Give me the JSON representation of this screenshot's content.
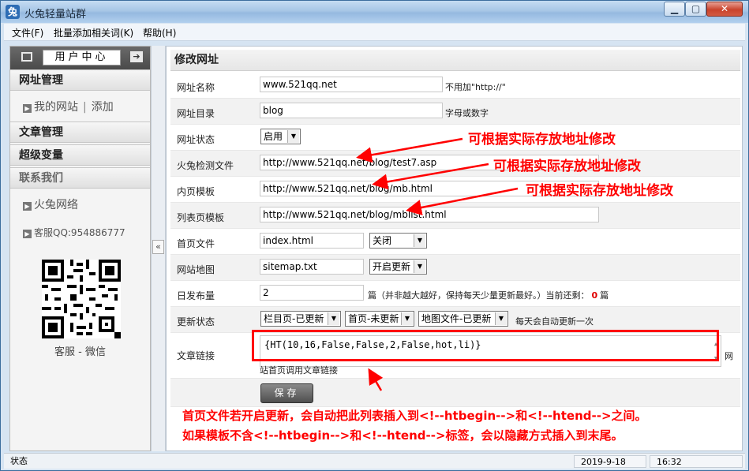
{
  "window": {
    "title": "火兔轻量站群",
    "minimize": "▁",
    "maximize": "▢",
    "close": "✕"
  },
  "menu": [
    "文件(F)",
    "批量添加相关词(K)",
    "帮助(H)"
  ],
  "sidebar": {
    "header_label": "用户中心",
    "arrow": "➔",
    "sections": {
      "site_manage": "网址管理",
      "my_sites": "我的网站",
      "add": "添加",
      "article_manage": "文章管理",
      "super_vars": "超级变量",
      "contact": "联系我们",
      "company": "火兔网络",
      "support_qq": "客服QQ:954886777"
    },
    "qr_caption": "客服 - 微信"
  },
  "collapse": "«",
  "main": {
    "title": "修改网址",
    "rows": {
      "name": {
        "label": "网址名称",
        "value": "www.521qq.net",
        "hint": "不用加\"http://\""
      },
      "dir": {
        "label": "网址目录",
        "value": "blog",
        "hint": "字母或数字"
      },
      "status": {
        "label": "网址状态",
        "value": "启用"
      },
      "check_file": {
        "label": "火兔检测文件",
        "value": "http://www.521qq.net/blog/test7.asp"
      },
      "content_tpl": {
        "label": "内页模板",
        "value": "http://www.521qq.net/blog/mb.html"
      },
      "list_tpl": {
        "label": "列表页模板",
        "value": "http://www.521qq.net/blog/mblist.html"
      },
      "home_file": {
        "label": "首页文件",
        "value": "index.html",
        "select": "关闭"
      },
      "sitemap": {
        "label": "网站地图",
        "value": "sitemap.txt",
        "select": "开启更新"
      },
      "daily": {
        "label": "日发布量",
        "value": "2",
        "unit": "篇",
        "hint": "（并非越大越好，保持每天少量更新最好。）当前还剩：",
        "remain": "0",
        "remain_unit": "篇"
      },
      "update": {
        "label": "更新状态",
        "sel1": "栏目页-已更新",
        "sel2": "首页-未更新",
        "sel3": "地图文件-已更新",
        "hint": "每天会自动更新一次"
      },
      "article_link": {
        "label": "文章链接",
        "value": "{HT(10,16,False,False,2,False,hot,li)}",
        "after": "网",
        "sub": "站首页调用文章链接"
      }
    },
    "save": "保存"
  },
  "annotations": {
    "modify_note": "可根据实际存放地址修改",
    "footer_line1": "首页文件若开启更新，会自动把此列表插入到<!--htbegin-->和<!--htend-->之间。",
    "footer_line2": "如果模板不含<!--htbegin-->和<!--htend-->标签，会以隐藏方式插入到末尾。"
  },
  "statusbar": {
    "status": "状态",
    "date": "2019-9-18",
    "time": "16:32"
  },
  "colors": {
    "annotation_red": "#ff0000",
    "counter_red": "#e00000"
  }
}
